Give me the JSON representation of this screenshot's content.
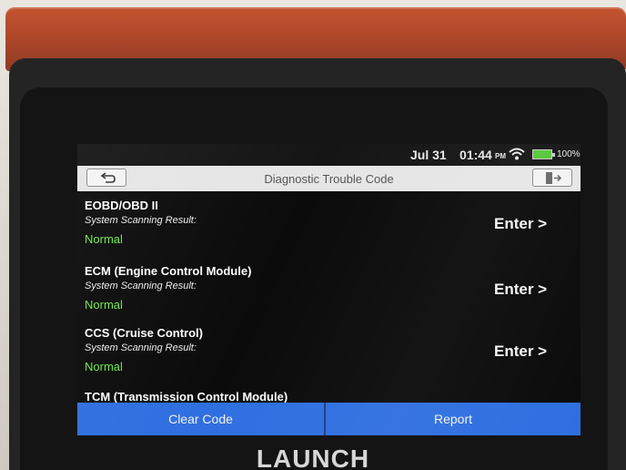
{
  "status_bar": {
    "date": "Jul 31",
    "time": "01:44",
    "ampm": "PM",
    "battery": "100%",
    "wifi_icon": "wifi-icon",
    "battery_icon": "battery-icon"
  },
  "header": {
    "title": "Diagnostic Trouble Code",
    "back_icon": "back-arrow-icon",
    "exit_icon": "exit-door-icon"
  },
  "systems": [
    {
      "name": "EOBD/OBD II",
      "subtitle": "System Scanning Result:",
      "status": "Normal",
      "action": "Enter >"
    },
    {
      "name": "ECM (Engine Control Module)",
      "subtitle": "System Scanning Result:",
      "status": "Normal",
      "action": "Enter >"
    },
    {
      "name": "CCS (Cruise Control)",
      "subtitle": "System Scanning Result:",
      "status": "Normal",
      "action": "Enter >"
    },
    {
      "name": "TCM (Transmission Control Module)"
    }
  ],
  "footer": {
    "clear_label": "Clear Code",
    "report_label": "Report"
  },
  "device": {
    "brand": "LAUNCH"
  },
  "colors": {
    "status_normal": "#6ee84a",
    "button_bar": "#2f6fe0",
    "bumper": "#b0472a"
  }
}
